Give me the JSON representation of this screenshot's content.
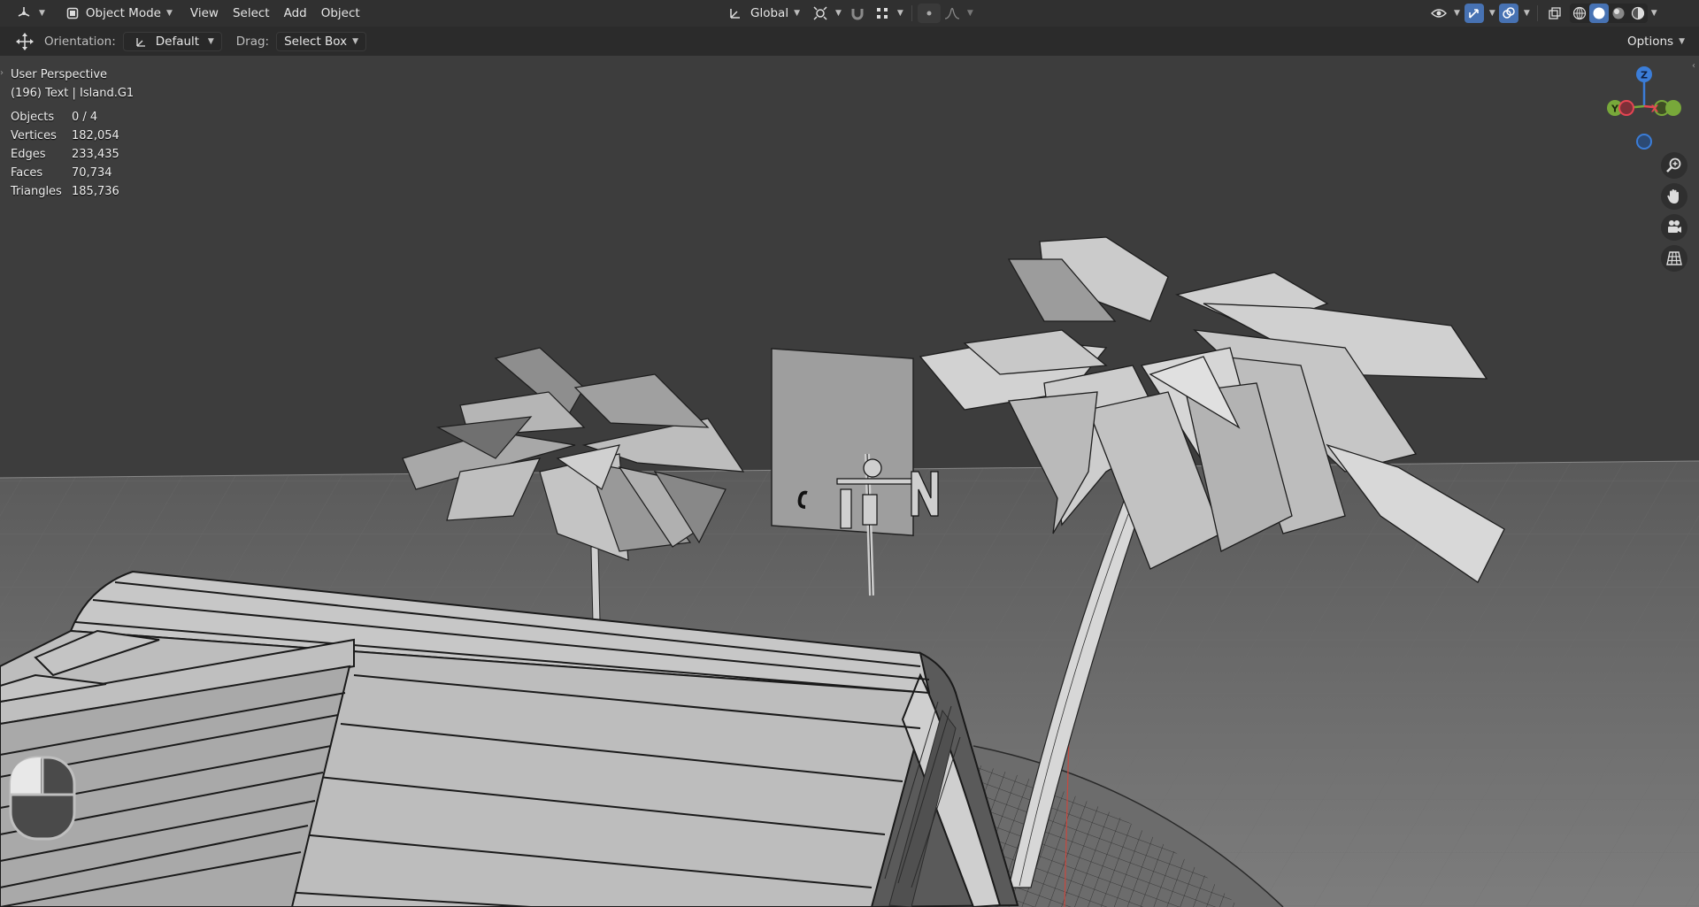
{
  "header": {
    "editor_type_icon": "3d-viewport-icon",
    "mode": "Object Mode",
    "menus": [
      "View",
      "Select",
      "Add",
      "Object"
    ],
    "transform_orientation": "Global"
  },
  "toolbar": {
    "tool_icon": "move-transform-icon",
    "orientation_label": "Orientation:",
    "orientation_value": "Default",
    "drag_label": "Drag:",
    "drag_value": "Select Box",
    "options_label": "Options"
  },
  "overlay": {
    "perspective": "User Perspective",
    "context": "(196) Text | Island.G1",
    "stats": [
      {
        "key": "Objects",
        "value": "0 / 4"
      },
      {
        "key": "Vertices",
        "value": "182,054"
      },
      {
        "key": "Edges",
        "value": "233,435"
      },
      {
        "key": "Faces",
        "value": "70,734"
      },
      {
        "key": "Triangles",
        "value": "185,736"
      }
    ]
  },
  "gizmo": {
    "z": "Z",
    "y": "Y",
    "x": "X",
    "colors": {
      "x": "#e64553",
      "y": "#78a83a",
      "z": "#3b7dd8"
    }
  },
  "nav_icons": [
    "zoom-icon",
    "hand-pan-icon",
    "camera-icon",
    "grid-ortho-icon"
  ],
  "colors": {
    "header_bg": "#303030",
    "toolbar_bg": "#2b2b2b",
    "viewport_bg": "#3d3d3d",
    "accent": "#4772b3"
  }
}
